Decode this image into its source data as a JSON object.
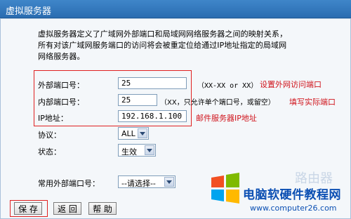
{
  "window": {
    "title": "虚拟服务器"
  },
  "description": [
    "虚拟服务器定义了广域网外部端口和局域网网络服务器之间的映射关系，",
    "所有对该广域网服务端口的访问将会被重定位给通过IP地址指定的局域网",
    "网络服务器。"
  ],
  "form": {
    "external_port": {
      "label": "外部端口号：",
      "value": "25",
      "hint": "（XX-XX or XX）",
      "annotation": "设置外网访问端口"
    },
    "internal_port": {
      "label": "内部端口号：",
      "value": "25",
      "hint": "（XX，只允许单个端口号，或留空）",
      "annotation": "填写实际端口"
    },
    "ip_address": {
      "label": "IP地址：",
      "value": "192.168.1.100",
      "annotation": "邮件服务器IP地址"
    },
    "protocol": {
      "label": "协议：",
      "selected": "ALL"
    },
    "status": {
      "label": "状态：",
      "selected": "生效"
    },
    "common_port": {
      "label": "常用外部端口号：",
      "selected": "--请选择--"
    }
  },
  "buttons": {
    "save": "保 存",
    "back": "返 回",
    "help": "帮 助"
  },
  "watermark": {
    "title": "电脑软硬件教程网",
    "url": "www.computer26.com",
    "bg_text": "路由器"
  },
  "colors": {
    "accent_red": "#d0141c",
    "titlebar": "#2f74bb",
    "watermark_blue": "#0b4fb3"
  }
}
